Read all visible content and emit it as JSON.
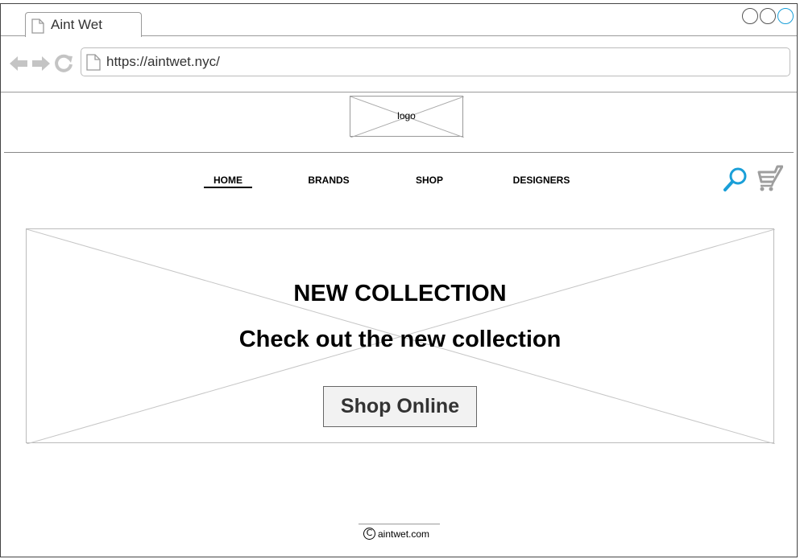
{
  "browser": {
    "tab_title": "Aint Wet",
    "url": "https://aintwet.nyc/"
  },
  "header": {
    "logo_text": "logo"
  },
  "nav": {
    "items": [
      {
        "label": "HOME",
        "active": true
      },
      {
        "label": "BRANDS",
        "active": false
      },
      {
        "label": "SHOP",
        "active": false
      },
      {
        "label": "DESIGNERS",
        "active": false
      }
    ],
    "search_icon": "search-icon",
    "cart_icon": "shopping-cart-icon"
  },
  "hero": {
    "title": "NEW COLLECTION",
    "subtitle": "Check out the new collection",
    "button_label": "Shop Online"
  },
  "footer": {
    "copyright_symbol": "C",
    "site": "aintwet.com"
  },
  "colors": {
    "accent": "#1a9fd8",
    "icon_gray": "#9e9e9e"
  }
}
